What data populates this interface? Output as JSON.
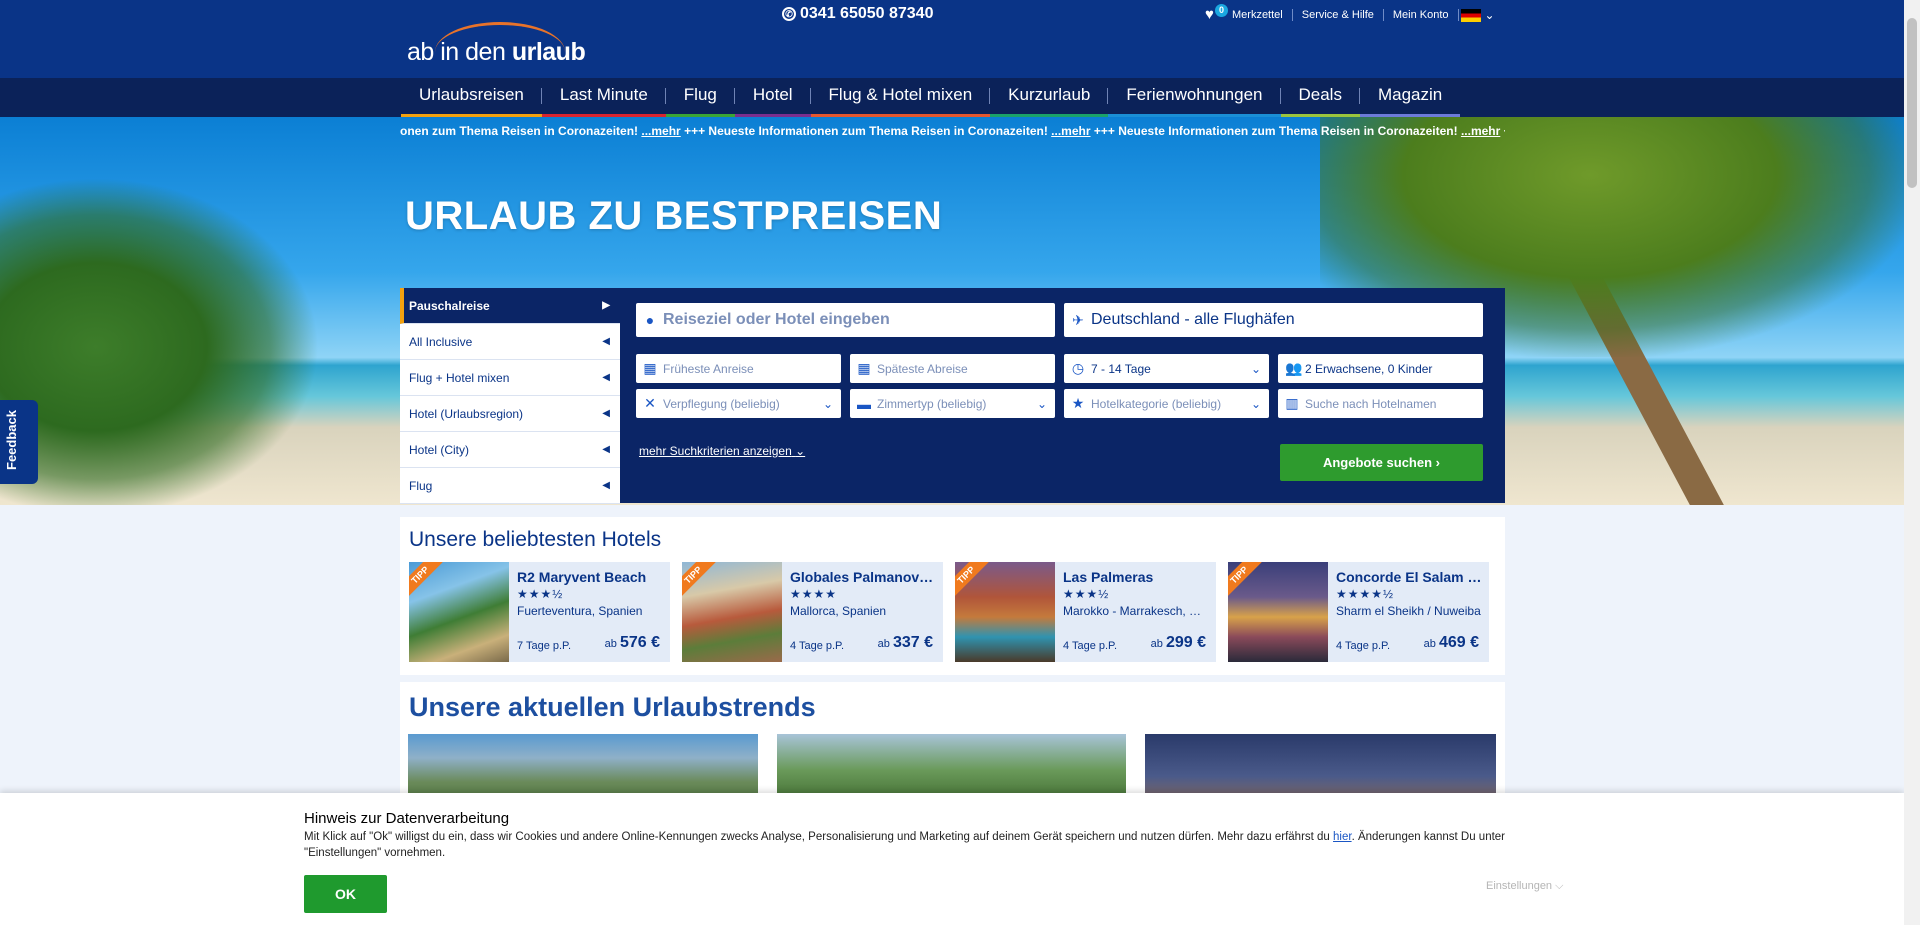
{
  "header": {
    "logo_text_regular": "ab in den ",
    "logo_text_bold": "urlaub",
    "phone": "0341 65050 87340",
    "links": [
      {
        "label": "Merkzettel",
        "badge": "0"
      },
      {
        "label": "Service & Hilfe"
      },
      {
        "label": "Mein Konto"
      }
    ],
    "language": "DE"
  },
  "nav": {
    "items": [
      {
        "label": "Urlaubsreisen",
        "color": "#f3a10f"
      },
      {
        "label": "Last Minute",
        "color": "#d9242f"
      },
      {
        "label": "Flug",
        "color": "#3aa635"
      },
      {
        "label": "Hotel",
        "color": "#7a2e8f"
      },
      {
        "label": "Flug & Hotel mixen",
        "color": "#e4572e"
      },
      {
        "label": "Kurzurlaub",
        "color": "#1aa36a"
      },
      {
        "label": "Ferienwohnungen",
        "color": "#1a8fd6"
      },
      {
        "label": "Deals",
        "color": "#9bc53d"
      },
      {
        "label": "Magazin",
        "color": "#6c7bd9"
      }
    ]
  },
  "ticker": {
    "text_start": "onen zum Thema Reisen in Coronazeiten! ",
    "link": "...mehr",
    "separator": " +++ Neueste Informationen zum Thema Reisen in Coronazeiten! "
  },
  "hero": {
    "title": "URLAUB ZU BESTPREISEN",
    "feedback": "Feedback"
  },
  "search": {
    "tabs": [
      {
        "label": "Pauschalreise",
        "active": true
      },
      {
        "label": "All Inclusive"
      },
      {
        "label": "Flug + Hotel mixen"
      },
      {
        "label": "Hotel (Urlaubsregion)"
      },
      {
        "label": "Hotel (City)"
      },
      {
        "label": "Flug"
      }
    ],
    "destination_placeholder": "Reiseziel oder Hotel eingeben",
    "departure_airport": "Deutschland - alle Flughäfen",
    "earliest_placeholder": "Früheste Anreise",
    "latest_placeholder": "Späteste Abreise",
    "duration": "7 - 14 Tage",
    "travelers": "2 Erwachsene, 0 Kinder",
    "board": "Verpflegung (beliebig)",
    "room": "Zimmertyp (beliebig)",
    "category": "Hotelkategorie (beliebig)",
    "hotel_name_placeholder": "Suche nach Hotelnamen",
    "more_criteria": "mehr Suchkriterien anzeigen",
    "submit": "Angebote suchen"
  },
  "hotels": {
    "title": "Unsere beliebtesten Hotels",
    "tag": "TIPP",
    "items": [
      {
        "name": "R2 Maryvent Beach",
        "stars": "★★★½",
        "location": "Fuerteventura, Spanien",
        "days": "7 Tage p.P.",
        "price_prefix": "ab",
        "price": "576 €"
      },
      {
        "name": "Globales Palmanova Palace",
        "stars": "★★★★",
        "location": "Mallorca, Spanien",
        "days": "4 Tage p.P.",
        "price_prefix": "ab",
        "price": "337 €"
      },
      {
        "name": "Las Palmeras",
        "stars": "★★★½",
        "location": "Marokko - Marrakesch, Marokko",
        "days": "4 Tage p.P.",
        "price_prefix": "ab",
        "price": "299 €"
      },
      {
        "name": "Concorde El Salam Sharm",
        "stars": "★★★★½",
        "location": "Sharm el Sheikh / Nuweiba",
        "days": "4 Tage p.P.",
        "price_prefix": "ab",
        "price": "469 €"
      }
    ]
  },
  "trends": {
    "title": "Unsere aktuellen Urlaubstrends"
  },
  "cookie": {
    "title": "Hinweis zur Datenverarbeitung",
    "text_before": "Mit Klick auf \"Ok\" willigst du ein, dass wir Cookies und andere Online-Kennungen zwecks Analyse, Personalisierung und Marketing auf deinem Gerät speichern und nutzen dürfen. Mehr dazu erfährst du ",
    "link": "hier",
    "text_after": ". Änderungen kannst Du unter \"Einstellungen\" vornehmen.",
    "ok": "OK",
    "settings": "Einstellungen ⌵"
  }
}
